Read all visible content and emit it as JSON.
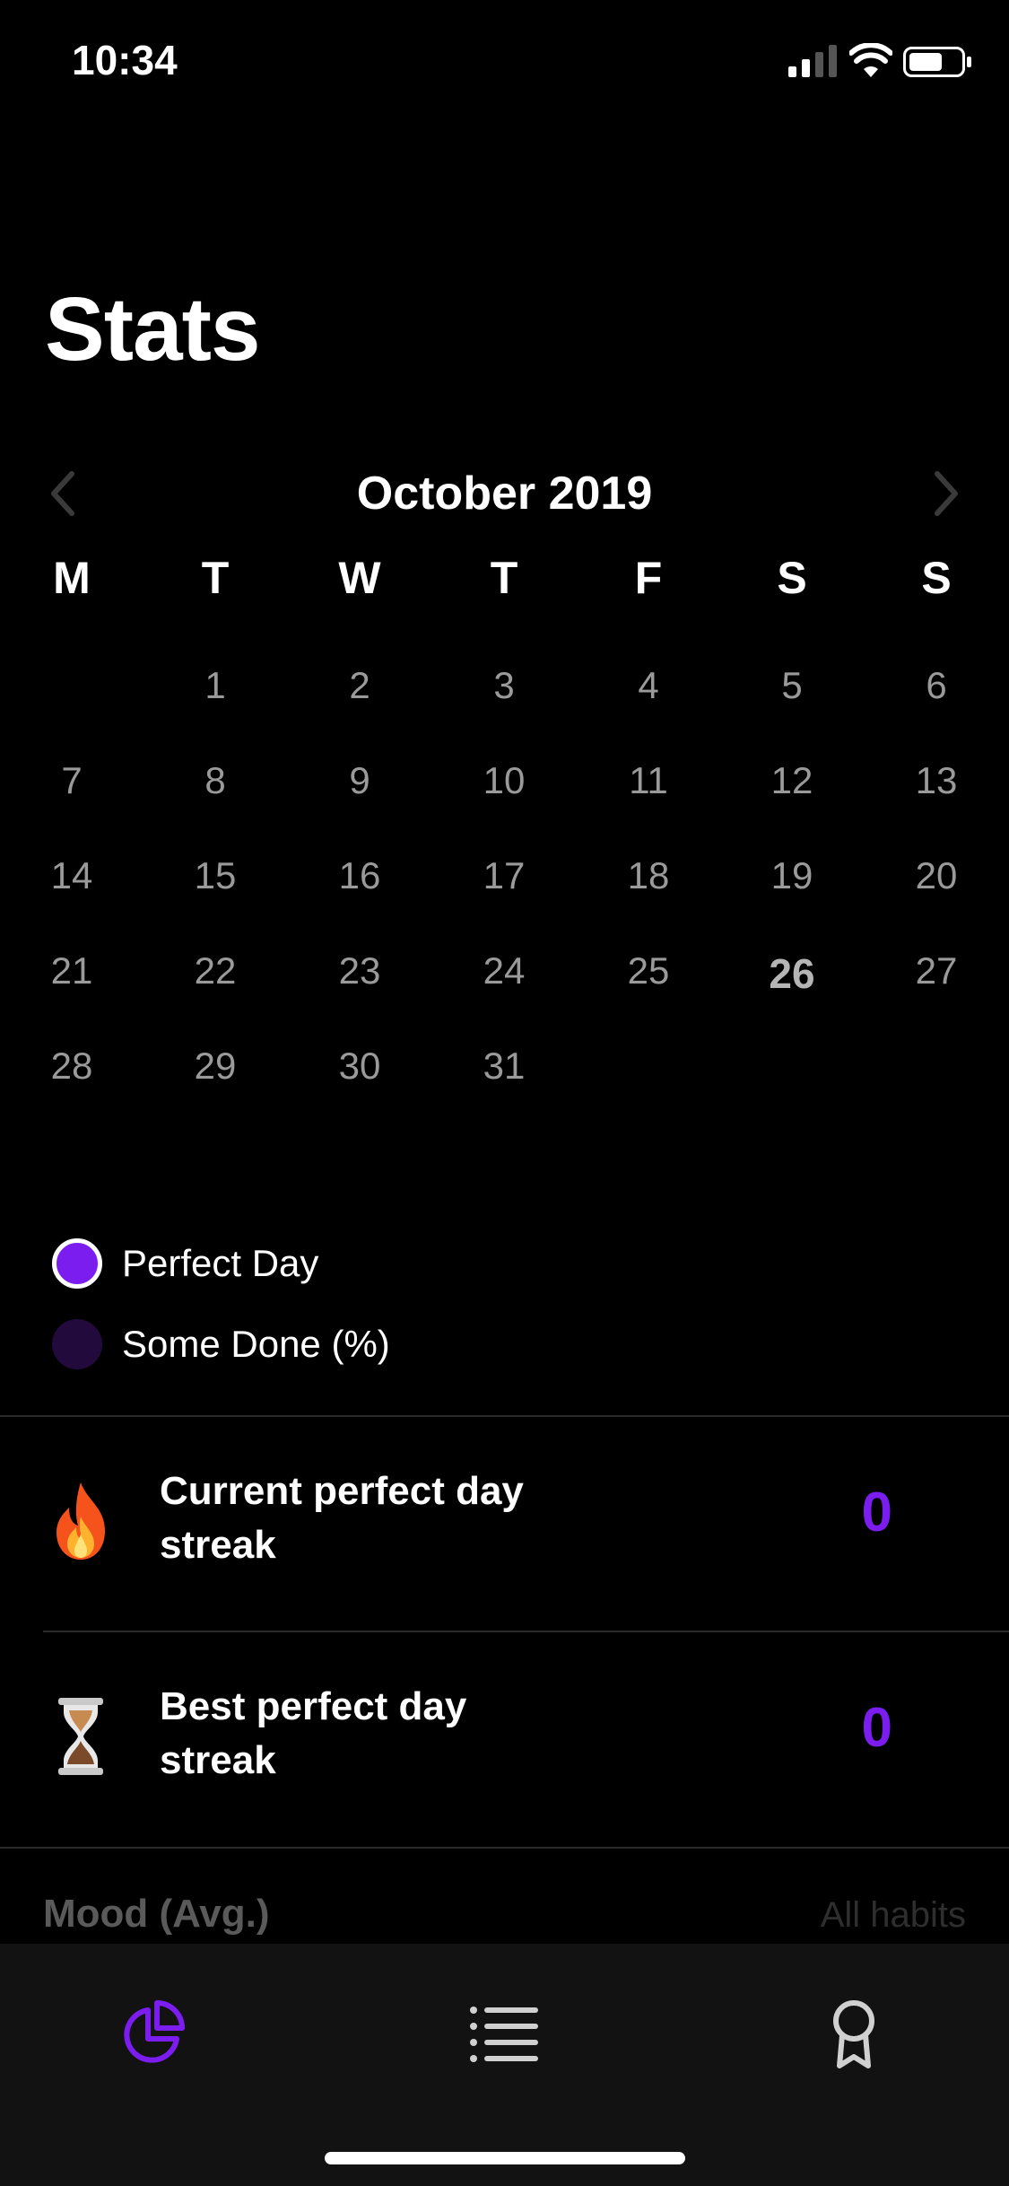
{
  "status_bar": {
    "time": "10:34"
  },
  "page_title": "Stats",
  "calendar": {
    "month_label": "October 2019",
    "weekdays": [
      "M",
      "T",
      "W",
      "T",
      "F",
      "S",
      "S"
    ],
    "weeks": [
      [
        "",
        "1",
        "2",
        "3",
        "4",
        "5",
        "6"
      ],
      [
        "7",
        "8",
        "9",
        "10",
        "11",
        "12",
        "13"
      ],
      [
        "14",
        "15",
        "16",
        "17",
        "18",
        "19",
        "20"
      ],
      [
        "21",
        "22",
        "23",
        "24",
        "25",
        "26",
        "27"
      ],
      [
        "28",
        "29",
        "30",
        "31",
        "",
        "",
        ""
      ]
    ],
    "today": "26"
  },
  "legend": {
    "perfect_day": "Perfect Day",
    "some_done": "Some Done (%)"
  },
  "stats": {
    "current": {
      "label": "Current perfect day streak",
      "value": "0"
    },
    "best": {
      "label": "Best perfect day streak",
      "value": "0"
    }
  },
  "mood": {
    "title": "Mood (Avg.)",
    "filter": "All habits"
  },
  "colors": {
    "accent": "#7c1df0",
    "some_done": "#230a3d",
    "background": "#000000"
  },
  "tabbar": {
    "icons": [
      "pie-chart-icon",
      "list-icon",
      "award-icon"
    ],
    "active": "pie-chart-icon"
  }
}
